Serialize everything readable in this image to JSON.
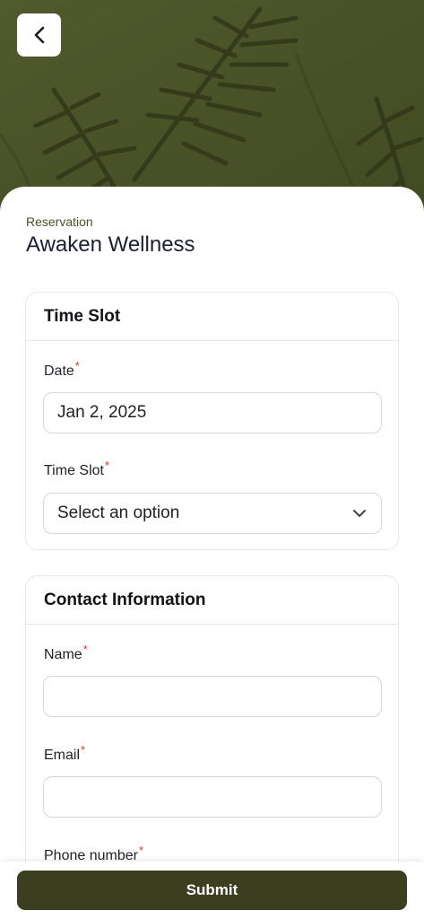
{
  "header": {
    "back_icon": "chevron-left-icon"
  },
  "reservation": {
    "eyebrow": "Reservation",
    "title": "Awaken Wellness"
  },
  "time_slot_card": {
    "heading": "Time Slot",
    "date_label": "Date",
    "date_value": "Jan 2, 2025",
    "slot_label": "Time Slot",
    "slot_placeholder": "Select an option"
  },
  "contact_card": {
    "heading": "Contact Information",
    "name_label": "Name",
    "name_value": "",
    "email_label": "Email",
    "email_value": "",
    "phone_label": "Phone number"
  },
  "required_marker": "*",
  "footer": {
    "submit_label": "Submit"
  },
  "colors": {
    "accent": "#3c3f1f",
    "hero": "#4a5228",
    "required": "#e03535"
  }
}
